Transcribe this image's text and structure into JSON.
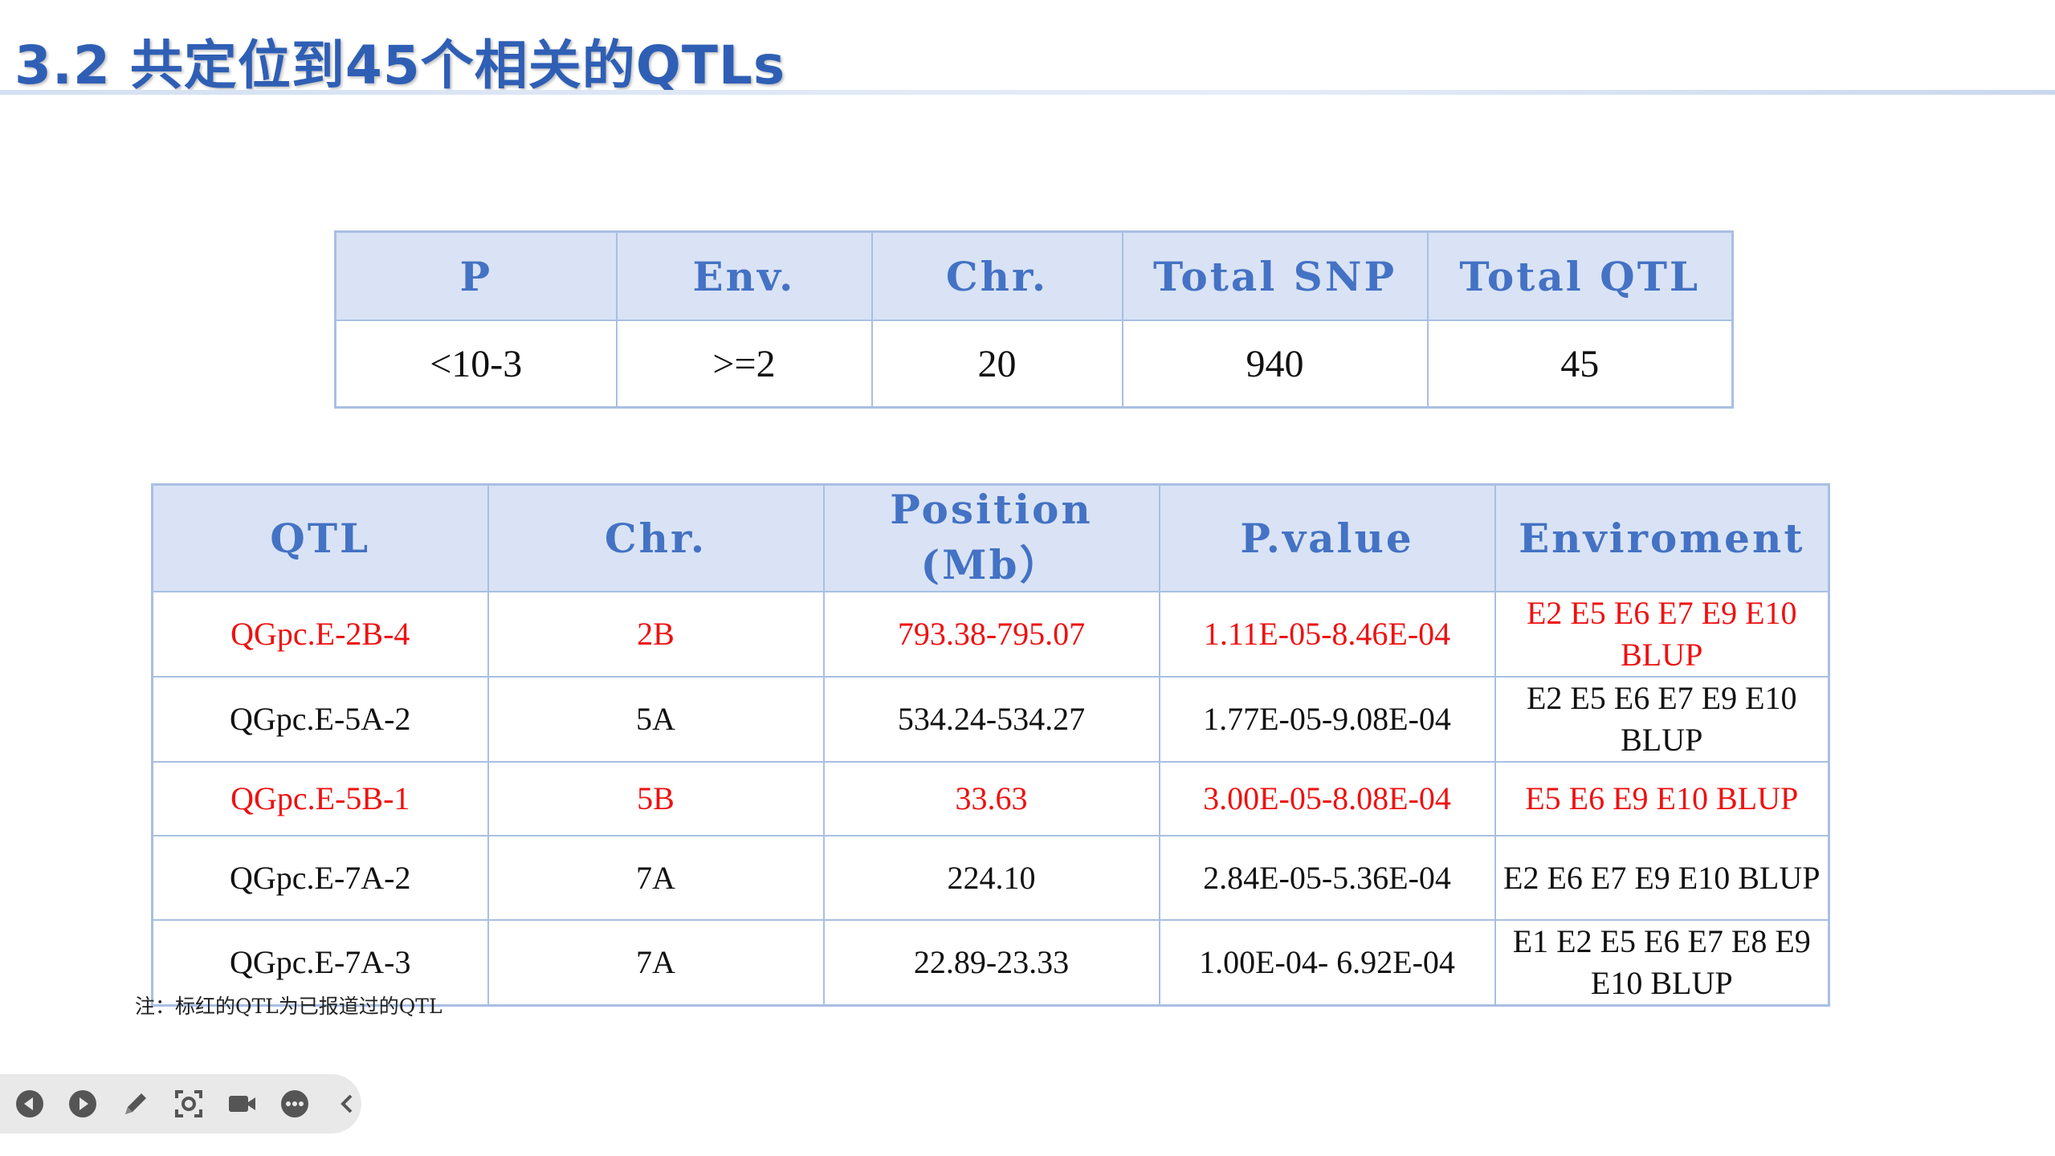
{
  "slide": {
    "title": "3.2 共定位到45个相关的QTLs",
    "footnote": "注：标红的QTL为已报道过的QTL"
  },
  "summary_table": {
    "headers": [
      "P",
      "Env.",
      "Chr.",
      "Total SNP",
      "Total QTL"
    ],
    "row": [
      "<10-3",
      ">=2",
      "20",
      "940",
      "45"
    ]
  },
  "qtl_table": {
    "headers": [
      "QTL",
      "Chr.",
      "Position (Mb）",
      "P.value",
      "Enviroment"
    ],
    "rows": [
      {
        "cells": [
          "QGpc.E-2B-4",
          "2B",
          "793.38-795.07",
          "1.11E-05-8.46E-04",
          "E2 E5 E6 E7 E9 E10 BLUP"
        ],
        "reported": true
      },
      {
        "cells": [
          "QGpc.E-5A-2",
          "5A",
          "534.24-534.27",
          "1.77E-05-9.08E-04",
          "E2 E5 E6 E7 E9 E10 BLUP"
        ],
        "reported": false
      },
      {
        "cells": [
          "QGpc.E-5B-1",
          "5B",
          "33.63",
          "3.00E-05-8.08E-04",
          "E5 E6 E9 E10 BLUP"
        ],
        "reported": true
      },
      {
        "cells": [
          "QGpc.E-7A-2",
          "7A",
          "224.10",
          "2.84E-05-5.36E-04",
          "E2 E6 E7 E9 E10 BLUP"
        ],
        "reported": false
      },
      {
        "cells": [
          "QGpc.E-7A-3",
          "7A",
          "22.89-23.33",
          "1.00E-04- 6.92E-04",
          "E1 E2 E5 E6 E7 E8 E9 E10 BLUP"
        ],
        "reported": false
      }
    ]
  },
  "toolbar": {
    "buttons": [
      {
        "icon": "previous-icon"
      },
      {
        "icon": "next-icon"
      },
      {
        "icon": "pen-icon"
      },
      {
        "icon": "zoom-focus-icon"
      },
      {
        "icon": "camera-icon"
      },
      {
        "icon": "more-icon"
      },
      {
        "icon": "collapse-icon"
      }
    ]
  },
  "colors": {
    "title": "#2f5fb5",
    "header_text": "#4472c4",
    "header_fill": "#d9e3f5",
    "border": "#a9bfe3",
    "reported_text": "#ee1111"
  }
}
